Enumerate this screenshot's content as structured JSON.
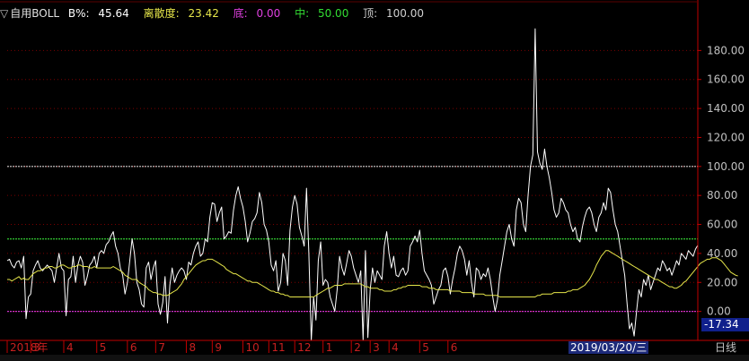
{
  "indicator_legend": {
    "prefix": "▽",
    "name": "自用BOLL",
    "b_label": "B%:",
    "b_value": "45.64",
    "disp_label": "离散度:",
    "disp_value": "23.42",
    "low_label": "底:",
    "low_value": "0.00",
    "mid_label": "中:",
    "mid_value": "50.00",
    "top_label": "顶:",
    "top_value": "100.00"
  },
  "colors": {
    "background": "#000000",
    "b_line": "#ffffff",
    "dispersion": "#e6e64a",
    "top_line": "#d0d0d0",
    "mid_line": "#33cc33",
    "low_line": "#cc33cc",
    "axis": "#c00000",
    "grid": "#7a0000",
    "date_tip_bg": "#1d2a7a",
    "value_tip_bg": "#10208c"
  },
  "cursor_value": "-17.34",
  "cursor_date": "2019/03/20/三",
  "period": "日线",
  "chart_data": {
    "type": "line",
    "title": "",
    "ylim": [
      -20,
      200
    ],
    "y_ticks": [
      "180.00",
      "160.00",
      "140.00",
      "120.00",
      "100.00",
      "80.00",
      "60.00",
      "40.00",
      "20.00",
      "0.00"
    ],
    "x_month_labels": [
      "2018年",
      "3",
      "4",
      "5",
      "6",
      "7",
      "8",
      "9",
      "10",
      "11",
      "12",
      "1",
      "2",
      "3",
      "4",
      "5",
      "6"
    ],
    "x_month_index": [
      0,
      10,
      24,
      38,
      51,
      63,
      76,
      87,
      100,
      111,
      122,
      134,
      146,
      154,
      162,
      175,
      187
    ],
    "reference_lines": [
      {
        "name": "顶",
        "value": 100
      },
      {
        "name": "中",
        "value": 50
      },
      {
        "name": "底",
        "value": 0
      }
    ],
    "series": [
      {
        "name": "B%",
        "values": [
          35,
          36,
          32,
          30,
          34,
          35,
          30,
          38,
          -5,
          10,
          12,
          28,
          32,
          35,
          30,
          28,
          30,
          32,
          30,
          28,
          20,
          30,
          40,
          30,
          28,
          -3,
          22,
          24,
          38,
          20,
          32,
          38,
          34,
          18,
          24,
          32,
          34,
          38,
          30,
          40,
          42,
          40,
          46,
          48,
          52,
          55,
          45,
          40,
          30,
          25,
          12,
          20,
          35,
          50,
          40,
          20,
          15,
          5,
          3,
          30,
          34,
          22,
          30,
          35,
          5,
          -2,
          6,
          24,
          -8,
          18,
          30,
          20,
          25,
          28,
          30,
          28,
          22,
          34,
          32,
          40,
          45,
          48,
          38,
          40,
          50,
          48,
          65,
          75,
          74,
          62,
          68,
          72,
          50,
          52,
          55,
          54,
          70,
          80,
          86,
          78,
          72,
          62,
          48,
          54,
          62,
          64,
          68,
          82,
          75,
          60,
          56,
          48,
          32,
          28,
          35,
          14,
          20,
          40,
          35,
          18,
          56,
          72,
          80,
          74,
          58,
          52,
          45,
          85,
          40,
          -20,
          10,
          -6,
          35,
          48,
          18,
          22,
          20,
          10,
          5,
          0,
          15,
          38,
          30,
          25,
          33,
          42,
          38,
          30,
          25,
          20,
          28,
          -20,
          42,
          -18,
          15,
          30,
          20,
          28,
          25,
          22,
          45,
          55,
          40,
          30,
          38,
          25,
          24,
          28,
          30,
          25,
          28,
          45,
          48,
          52,
          48,
          56,
          40,
          28,
          25,
          22,
          18,
          5,
          10,
          15,
          18,
          28,
          30,
          24,
          12,
          22,
          30,
          40,
          45,
          42,
          36,
          25,
          35,
          20,
          10,
          30,
          28,
          22,
          26,
          24,
          30,
          22,
          10,
          0,
          8,
          25,
          35,
          45,
          55,
          60,
          50,
          45,
          70,
          78,
          75,
          60,
          55,
          80,
          100,
          108,
          195,
          110,
          102,
          98,
          112,
          100,
          92,
          82,
          70,
          65,
          68,
          78,
          75,
          70,
          68,
          60,
          55,
          58,
          50,
          48,
          58,
          65,
          70,
          72,
          68,
          60,
          55,
          65,
          68,
          75,
          70,
          85,
          82,
          70,
          60,
          55,
          45,
          35,
          25,
          5,
          -12,
          -8,
          -17,
          0,
          15,
          10,
          22,
          18,
          25,
          15,
          20,
          25,
          30,
          28,
          35,
          32,
          28,
          30,
          25,
          30,
          35,
          32,
          40,
          38,
          36,
          42,
          40,
          38,
          43,
          45.64
        ]
      },
      {
        "name": "离散度",
        "values": [
          22,
          22,
          21,
          22,
          23,
          24,
          22,
          23,
          22,
          22,
          24,
          26,
          27,
          28,
          28,
          29,
          30,
          30,
          31,
          31,
          30,
          30,
          31,
          32,
          32,
          31,
          30,
          30,
          31,
          31,
          32,
          32,
          31,
          31,
          31,
          30,
          30,
          31,
          30,
          30,
          30,
          30,
          30,
          30,
          30,
          31,
          30,
          29,
          28,
          27,
          25,
          24,
          23,
          22,
          22,
          22,
          20,
          19,
          18,
          17,
          15,
          14,
          13,
          13,
          12,
          12,
          11,
          11,
          11,
          12,
          13,
          14,
          15,
          17,
          19,
          22,
          24,
          26,
          28,
          30,
          32,
          33,
          34,
          35,
          35,
          36,
          36,
          36,
          35,
          34,
          33,
          32,
          31,
          29,
          28,
          27,
          26,
          26,
          25,
          24,
          23,
          22,
          21,
          21,
          20,
          20,
          20,
          19,
          18,
          17,
          16,
          15,
          14,
          14,
          13,
          13,
          12,
          12,
          11,
          11,
          10,
          10,
          10,
          10,
          10,
          10,
          10,
          10,
          10,
          10,
          10,
          11,
          12,
          13,
          14,
          15,
          16,
          16,
          17,
          18,
          18,
          18,
          18,
          19,
          19,
          19,
          19,
          19,
          19,
          19,
          19,
          18,
          17,
          17,
          16,
          16,
          16,
          16,
          15,
          15,
          14,
          14,
          14,
          14,
          15,
          15,
          16,
          16,
          17,
          17,
          18,
          18,
          18,
          18,
          18,
          18,
          17,
          17,
          17,
          16,
          16,
          16,
          15,
          15,
          15,
          15,
          15,
          15,
          14,
          14,
          14,
          14,
          14,
          13,
          13,
          13,
          13,
          13,
          12,
          12,
          12,
          12,
          12,
          11,
          11,
          11,
          11,
          11,
          11,
          10,
          10,
          10,
          10,
          10,
          10,
          10,
          10,
          10,
          10,
          10,
          10,
          10,
          10,
          10,
          10,
          11,
          11,
          12,
          12,
          12,
          12,
          12,
          13,
          13,
          13,
          13,
          13,
          13,
          14,
          14,
          15,
          15,
          15,
          16,
          17,
          18,
          20,
          22,
          25,
          28,
          32,
          35,
          38,
          40,
          42,
          42,
          41,
          40,
          39,
          38,
          37,
          36,
          35,
          34,
          33,
          32,
          31,
          30,
          29,
          28,
          27,
          26,
          25,
          24,
          23,
          22,
          22,
          21,
          20,
          19,
          18,
          17,
          17,
          16,
          16,
          17,
          18,
          20,
          21,
          23,
          25,
          27,
          29,
          31,
          33,
          34,
          35,
          36,
          36,
          37,
          37,
          37,
          36,
          35,
          33,
          31,
          29,
          27,
          26,
          25,
          24.5
        ]
      }
    ]
  }
}
